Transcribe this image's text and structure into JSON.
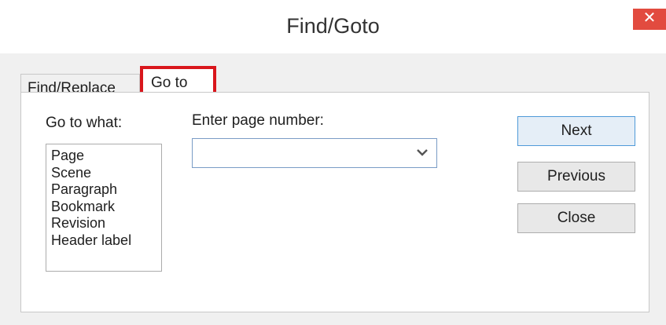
{
  "window": {
    "title": "Find/Goto",
    "close_glyph": "✕"
  },
  "tabs": [
    {
      "label": "Find/Replace",
      "selected": false
    },
    {
      "label": "Go to",
      "selected": true
    }
  ],
  "goto_panel": {
    "goto_what_label": "Go to what:",
    "goto_what_items": [
      "Page",
      "Scene",
      "Paragraph",
      "Bookmark",
      "Revision",
      "Header label"
    ],
    "page_number_label": "Enter page number:",
    "page_number_value": ""
  },
  "buttons": {
    "next": "Next",
    "previous": "Previous",
    "close": "Close"
  },
  "colors": {
    "close_button_bg": "#e24b3f",
    "highlight_border": "#d9161c",
    "focused_input_border": "#7a9cc6",
    "default_button_border": "#4f9ad8"
  },
  "icons": {
    "close": "close-icon",
    "dropdown": "chevron-down-icon"
  }
}
